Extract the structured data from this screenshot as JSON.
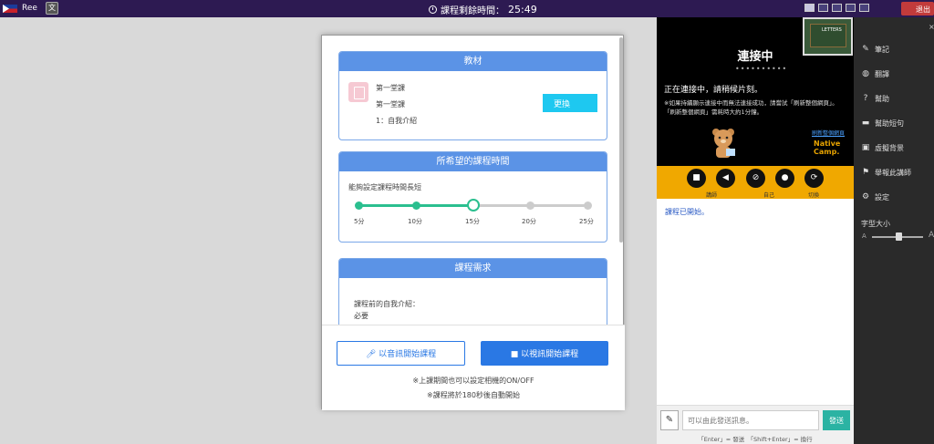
{
  "topbar": {
    "app_name": "Ree",
    "timer_label": "課程剩餘時間：",
    "timer_value": "25:49",
    "exit_label": "退出"
  },
  "video": {
    "connecting_title": "連接中",
    "dots": "••••••••••",
    "connecting_msg": "正在連接中，請稍候片刻。",
    "note": "※如果持續顯示連接中而無法連接成功，請嘗試「刷新整個網頁」。「刷新整個網頁」需耗時大約1分鐘。",
    "refresh_link": "刷新整個網頁",
    "logo_line1": "Native",
    "logo_line2": "Camp.",
    "thumb_text": "LETTERS"
  },
  "controls": {
    "label_lecturer": "講師",
    "label_self": "自己",
    "label_switch": "切換"
  },
  "chat": {
    "first_message": "課程已開始。",
    "input_placeholder": "可以由此發送訊息。",
    "send_label": "發送",
    "hint": "「Enter」= 發送　「Shift+Enter」= 換行"
  },
  "side_menu": {
    "items": [
      {
        "label": "筆記",
        "icon": "pencil-icon"
      },
      {
        "label": "翻譯",
        "icon": "globe-icon"
      },
      {
        "label": "幫助",
        "icon": "question-icon"
      },
      {
        "label": "幫助短句",
        "icon": "speech-icon"
      },
      {
        "label": "虛擬背景",
        "icon": "image-icon"
      },
      {
        "label": "舉報此講師",
        "icon": "flag-icon"
      },
      {
        "label": "設定",
        "icon": "gear-icon"
      }
    ],
    "font_size_label": "字型大小",
    "font_small": "A",
    "font_large": "A"
  },
  "modal": {
    "material": {
      "header": "教材",
      "line1": "第一堂課",
      "line2": "第一堂課",
      "line3": "1：自我介紹",
      "change_label": "更換"
    },
    "duration": {
      "header": "所希望的課程時間",
      "subtitle": "能夠設定課程時間長短",
      "ticks": [
        "5分",
        "10分",
        "15分",
        "20分",
        "25分"
      ],
      "selected": "15分"
    },
    "request": {
      "header": "課程需求",
      "line1": "課程前的自我介紹：",
      "line2": "必要"
    },
    "audio_button": "以音訊開始課程",
    "video_button": "以視訊開始課程",
    "note1": "※上課期間也可以設定相機的ON/OFF",
    "note2": "※課程將於180秒後自動開始"
  }
}
